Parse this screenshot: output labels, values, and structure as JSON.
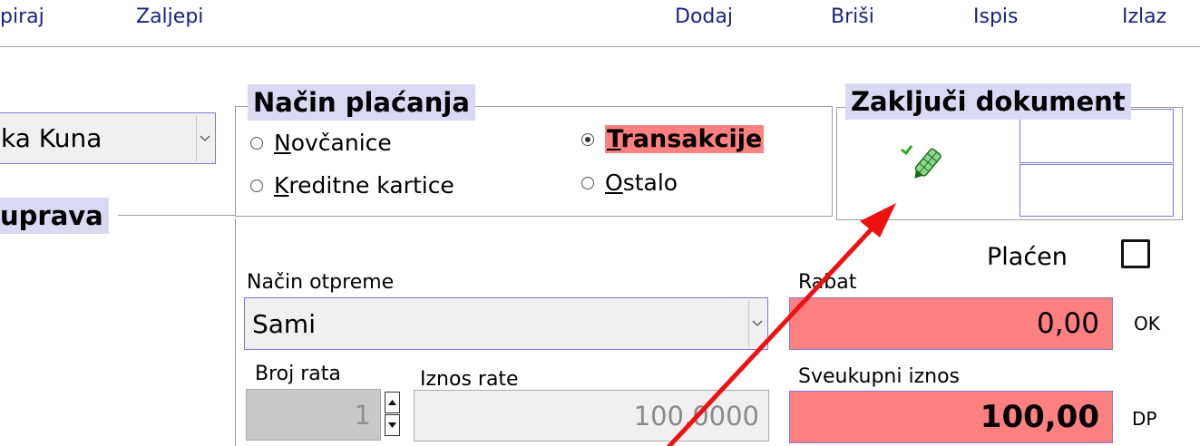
{
  "menu": {
    "kopiraj": "piraj",
    "zaljepi": "Zaljepi",
    "dodaj": "Dodaj",
    "brisi": "Briši",
    "ispis": "Ispis",
    "izlaz": "Izlaz"
  },
  "currency": {
    "value": "ka Kuna"
  },
  "uprava": {
    "legend": "uprava"
  },
  "payment": {
    "legend": "Način plaćanja",
    "options": [
      {
        "label": "Novčanice",
        "underline": "N",
        "rest": "ovčanice",
        "checked": false
      },
      {
        "label": "Transakcije",
        "underline": "T",
        "rest": "ransakcije",
        "checked": true
      },
      {
        "label": "Kreditne kartice",
        "underline": "K",
        "rest": "reditne kartice",
        "checked": false
      },
      {
        "label": "Ostalo",
        "underline": "O",
        "rest": "stalo",
        "checked": false
      }
    ],
    "highlight_color": "#ff8080"
  },
  "close_document": {
    "legend": "Zaključi dokument",
    "icon": "pen-icon"
  },
  "placen": {
    "label": "Plaćen",
    "checked": false
  },
  "shipping": {
    "label": "Način otpreme",
    "value": "Sami"
  },
  "rabat": {
    "label": "Rabat",
    "value": "0,00",
    "suffix": "OK"
  },
  "installments": {
    "broj_label": "Broj rata",
    "broj_value": "1",
    "iznos_label": "Iznos rate",
    "iznos_value": "100,0000"
  },
  "total": {
    "label": "Sveukupni iznos",
    "value": "100,00",
    "suffix": "DP"
  },
  "colors": {
    "accent": "#1a237e",
    "field_red": "#ff8080",
    "legend_bg": "#d9d9f3",
    "border_blue": "#7b7bd8",
    "arrow": "#ee1111"
  }
}
